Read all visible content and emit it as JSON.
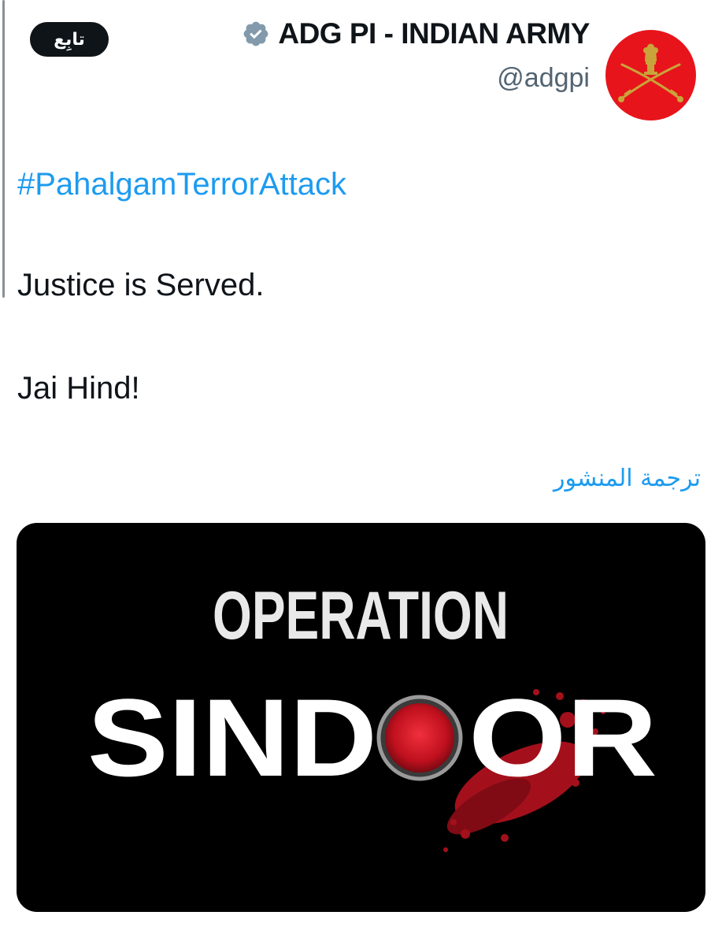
{
  "account": {
    "display_name": "ADG PI - INDIAN ARMY",
    "handle": "@adgpi",
    "verified_icon": "verified-badge-icon",
    "avatar_color": "#e8141b",
    "follow_label": "تابِع"
  },
  "post": {
    "hashtag": "#PahalgamTerrorAttack",
    "line1": "Justice is Served.",
    "line2": "Jai Hind!",
    "translate_label": "ترجمة المنشور"
  },
  "media": {
    "title_top": "OPERATION",
    "title_bottom_left": "SIND",
    "title_bottom_right": "OR",
    "accent_color": "#d41c2c",
    "background": "#000000"
  },
  "colors": {
    "link": "#1d9bf0",
    "text": "#0f1419",
    "secondary": "#536471"
  }
}
